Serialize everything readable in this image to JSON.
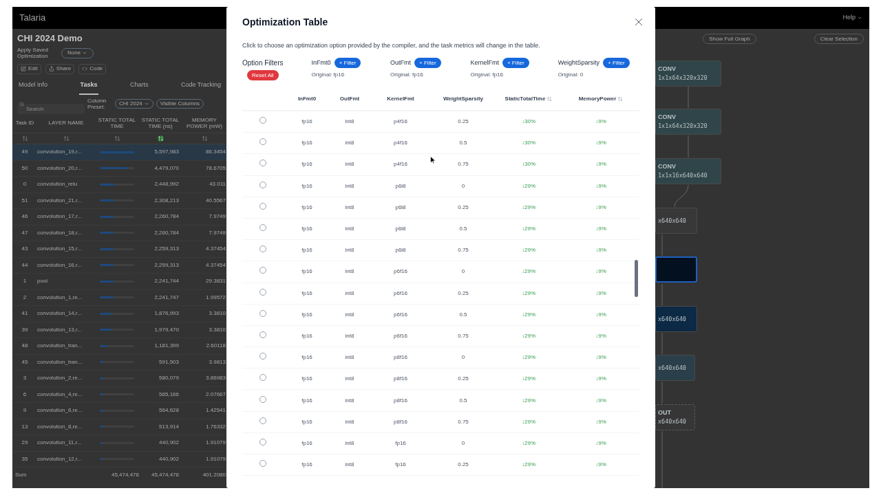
{
  "app": {
    "brand": "Talaria",
    "help": "Help"
  },
  "project": {
    "title": "CHI 2024 Demo",
    "apply_label": "Apply Saved Optimization",
    "apply_value": "None"
  },
  "actions": [
    {
      "kind": "edit",
      "label": "Edit"
    },
    {
      "kind": "share",
      "label": "Share"
    },
    {
      "kind": "code",
      "label": "Code"
    }
  ],
  "tabs": [
    {
      "label": "Model Info",
      "selected": false
    },
    {
      "label": "Tasks",
      "selected": true
    },
    {
      "label": "Charts",
      "selected": false
    },
    {
      "label": "Code Tracking",
      "selected": false
    }
  ],
  "search": {
    "placeholder": "Search"
  },
  "column_preset": {
    "label": "Column Preset:",
    "value": "CHI 2024"
  },
  "visible_columns": "Visible Columns",
  "tasks_table": {
    "columns": [
      {
        "label": "Task ID",
        "sorted": false
      },
      {
        "label": "LAYER NAME",
        "sorted": false
      },
      {
        "label": "STATIC TOTAL TIME",
        "sorted": false
      },
      {
        "label": "STATIC TOTAL TIME (ns)",
        "sorted": true
      },
      {
        "label": "MEMORY POWER (mW)",
        "sorted": false
      }
    ],
    "rows": [
      {
        "id": "49",
        "name": "convolution_19,r...",
        "level": 1,
        "time": "5,597,983",
        "power": "86.3454",
        "selected": true
      },
      {
        "id": "50",
        "name": "convolution_20,r...",
        "level": 0.8,
        "time": "4,479,070",
        "power": "78.6705",
        "selected": false
      },
      {
        "id": "0",
        "name": "convolution_relu",
        "level": 0.44,
        "time": "2,448,992",
        "power": "43.011",
        "selected": false
      },
      {
        "id": "51",
        "name": "convolution_21,r...",
        "level": 0.41,
        "time": "2,308,213",
        "power": "40.5567",
        "selected": false
      },
      {
        "id": "46",
        "name": "convolution_17,r...",
        "level": 0.4,
        "time": "2,260,784",
        "power": "7.9749",
        "selected": false
      },
      {
        "id": "47",
        "name": "convolution_18,r...",
        "level": 0.4,
        "time": "2,260,784",
        "power": "7.9749",
        "selected": false
      },
      {
        "id": "43",
        "name": "convolution_15,r...",
        "level": 0.4,
        "time": "2,259,313",
        "power": "4.37454",
        "selected": false
      },
      {
        "id": "44",
        "name": "convolution_16,r...",
        "level": 0.4,
        "time": "2,259,313",
        "power": "4.37454",
        "selected": false
      },
      {
        "id": "1",
        "name": "pool",
        "level": 0.4,
        "time": "2,241,744",
        "power": "29.3831",
        "selected": false
      },
      {
        "id": "2",
        "name": "convolution_1,re...",
        "level": 0.4,
        "time": "2,241,747",
        "power": "1.99572",
        "selected": false
      },
      {
        "id": "41",
        "name": "convolution_14,r...",
        "level": 0.34,
        "time": "1,876,993",
        "power": "3.3810",
        "selected": false
      },
      {
        "id": "39",
        "name": "convolution_13,r...",
        "level": 0.34,
        "time": "1,979,470",
        "power": "3.3810",
        "selected": false
      },
      {
        "id": "48",
        "name": "convolution_tran...",
        "level": 0.21,
        "time": "1,181,399",
        "power": "2.60118",
        "selected": false
      },
      {
        "id": "45",
        "name": "convolution_tran...",
        "level": 0.1,
        "time": "591,503",
        "power": "3.9813",
        "selected": false
      },
      {
        "id": "3",
        "name": "convolution_2,re...",
        "level": 0.1,
        "time": "580,079",
        "power": "3.86983",
        "selected": false
      },
      {
        "id": "6",
        "name": "convolution_4,re...",
        "level": 0.1,
        "time": "585,166",
        "power": "2.07667",
        "selected": false
      },
      {
        "id": "9",
        "name": "convolution_6,re...",
        "level": 0.1,
        "time": "564,628",
        "power": "1.42541",
        "selected": false
      },
      {
        "id": "13",
        "name": "convolution_8,re...",
        "level": 0.09,
        "time": "513,914",
        "power": "1.76332",
        "selected": false
      },
      {
        "id": "29",
        "name": "convolution_11,r...",
        "level": 0.08,
        "time": "440,902",
        "power": "1.91079",
        "selected": false
      },
      {
        "id": "35",
        "name": "convolution_12,r...",
        "level": 0.08,
        "time": "440,902",
        "power": "1.91079",
        "selected": false
      }
    ],
    "sum": {
      "label": "Sum",
      "total_a": "45,474,476",
      "total_b": "45,474,476",
      "power": "401.2080"
    }
  },
  "graph": {
    "buttons": [
      "Show Full Graph",
      "Clear Selection"
    ],
    "nodes": [
      {
        "kind": "op",
        "op": "CONV",
        "shape": "1x1x64x320x320",
        "color": "#2f4549",
        "selected": false
      },
      {
        "kind": "op",
        "op": "CONV",
        "shape": "1x1x64x320x320",
        "color": "#2f4549",
        "selected": false
      },
      {
        "kind": "op",
        "op": "CONV",
        "shape": "1x1x16x640x640",
        "color": "#2f4549",
        "selected": false
      },
      {
        "kind": "op",
        "shape": "x640x640",
        "color": "#383838",
        "selected": false
      },
      {
        "kind": "op",
        "color": "#03101f",
        "selected": true
      },
      {
        "kind": "op",
        "shape": "x640x640",
        "color": "#0c2a45",
        "selected": false
      },
      {
        "kind": "op",
        "shape": "x640x640",
        "color": "#2a3f4a",
        "selected": false
      },
      {
        "kind": "output",
        "op": "OUT",
        "shape": "x640x640",
        "color": "#363636",
        "selected": false
      }
    ]
  },
  "modal": {
    "title": "Optimization Table",
    "description": "Click to choose an optimization option provided by the compiler, and the task metrics will change in the table.",
    "filters_label": "Option Filters",
    "reset": "Reset All",
    "filters": [
      {
        "name": "InFmt0",
        "button": "+ Filter",
        "original": "Original: fp16"
      },
      {
        "name": "OutFmt",
        "button": "+ Filter",
        "original": "Original: fp16"
      },
      {
        "name": "KernelFmt",
        "button": "+ Filter",
        "original": "Original: fp16"
      },
      {
        "name": "WeightSparsity",
        "button": "+ Filter",
        "original": "Original: 0"
      }
    ],
    "columns": [
      {
        "label": "InFmt0",
        "sortable": false
      },
      {
        "label": "OutFmt",
        "sortable": false
      },
      {
        "label": "KernelFmt",
        "sortable": false
      },
      {
        "label": "WeightSparsity",
        "sortable": false
      },
      {
        "label": "StaticTotalTime",
        "sortable": true
      },
      {
        "label": "MemoryPower",
        "sortable": true
      }
    ],
    "rows": [
      {
        "selected": false,
        "cells": [
          "fp16",
          "int8",
          "p4f16",
          "0.25",
          "↓30%",
          "↓9%"
        ]
      },
      {
        "selected": false,
        "cells": [
          "fp16",
          "int8",
          "p4f16",
          "0.5",
          "↓30%",
          "↓9%"
        ]
      },
      {
        "selected": false,
        "cells": [
          "fp16",
          "int8",
          "p4f16",
          "0.75",
          "↓30%",
          "↓9%"
        ]
      },
      {
        "selected": false,
        "cells": [
          "fp16",
          "int8",
          "p6i8",
          "0",
          "↓29%",
          "↓9%"
        ]
      },
      {
        "selected": false,
        "cells": [
          "fp16",
          "int8",
          "p6i8",
          "0.25",
          "↓29%",
          "↓9%"
        ]
      },
      {
        "selected": false,
        "cells": [
          "fp16",
          "int8",
          "p6i8",
          "0.5",
          "↓29%",
          "↓9%"
        ]
      },
      {
        "selected": false,
        "cells": [
          "fp16",
          "int8",
          "p6i8",
          "0.75",
          "↓29%",
          "↓9%"
        ]
      },
      {
        "selected": false,
        "cells": [
          "fp16",
          "int8",
          "p6f16",
          "0",
          "↓29%",
          "↓9%"
        ]
      },
      {
        "selected": false,
        "cells": [
          "fp16",
          "int8",
          "p6f16",
          "0.25",
          "↓29%",
          "↓9%"
        ]
      },
      {
        "selected": false,
        "cells": [
          "fp16",
          "int8",
          "p6f16",
          "0.5",
          "↓29%",
          "↓9%"
        ]
      },
      {
        "selected": false,
        "cells": [
          "fp16",
          "int8",
          "p6f16",
          "0.75",
          "↓29%",
          "↓9%"
        ]
      },
      {
        "selected": false,
        "cells": [
          "fp16",
          "int8",
          "p8f16",
          "0",
          "↓29%",
          "↓9%"
        ]
      },
      {
        "selected": false,
        "cells": [
          "fp16",
          "int8",
          "p8f16",
          "0.25",
          "↓29%",
          "↓9%"
        ]
      },
      {
        "selected": false,
        "cells": [
          "fp16",
          "int8",
          "p8f16",
          "0.5",
          "↓29%",
          "↓9%"
        ]
      },
      {
        "selected": false,
        "cells": [
          "fp16",
          "int8",
          "p8f16",
          "0.75",
          "↓29%",
          "↓9%"
        ]
      },
      {
        "selected": false,
        "cells": [
          "fp16",
          "int8",
          "fp16",
          "0",
          "↓29%",
          "↓9%"
        ]
      },
      {
        "selected": false,
        "cells": [
          "fp16",
          "int8",
          "fp16",
          "0.25",
          "↓29%",
          "↓9%"
        ]
      }
    ]
  }
}
